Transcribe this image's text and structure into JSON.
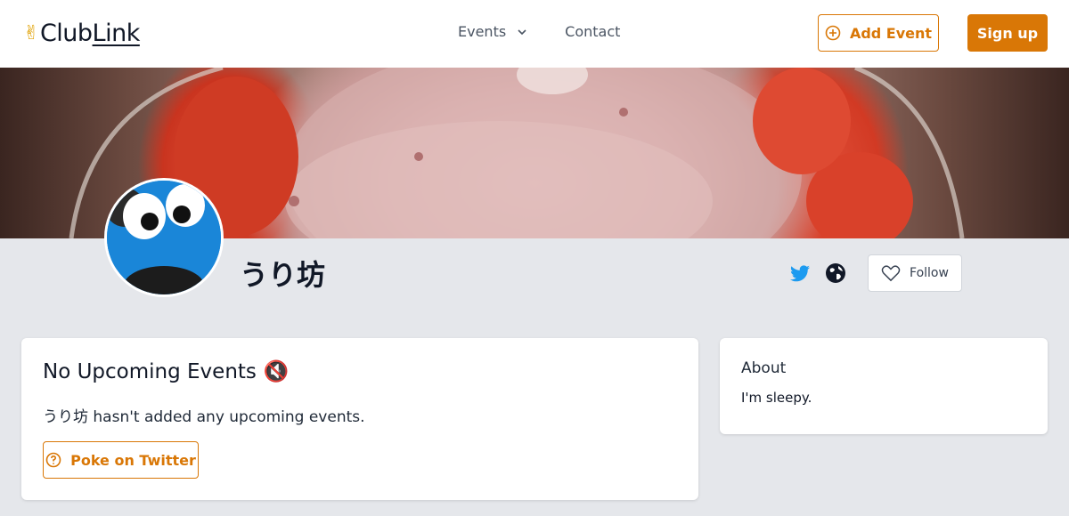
{
  "header": {
    "logo_emoji": "✌",
    "logo_club": "Club",
    "logo_link": "Link",
    "nav_events": "Events",
    "nav_contact": "Contact",
    "add_event_label": "Add Event",
    "signup_label": "Sign up"
  },
  "profile": {
    "name": "うり坊",
    "follow_label": "Follow"
  },
  "events_card": {
    "title": "No Upcoming Events",
    "title_emoji": "🔇",
    "message": "うり坊 hasn't added any upcoming events.",
    "poke_label": "Poke on Twitter"
  },
  "about_card": {
    "title": "About",
    "text": "I'm sleepy."
  },
  "colors": {
    "accent": "#d97706",
    "twitter": "#1d9bf0",
    "background": "#e5e7eb"
  },
  "icons": {
    "events_chevron": "chevron-down-icon",
    "add_event": "plus-circle-icon",
    "twitter": "twitter-icon",
    "website": "globe-icon",
    "follow": "heart-icon",
    "poke": "question-circle-icon"
  }
}
